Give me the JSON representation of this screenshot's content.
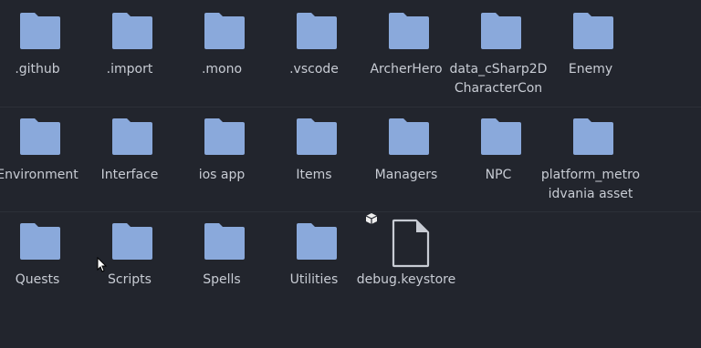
{
  "colors": {
    "background": "#22252d",
    "folder": "#8aa9db",
    "label": "#c8ccd4",
    "file_outline": "#c8ccd4"
  },
  "items": [
    {
      "label": ".github",
      "type": "folder"
    },
    {
      "label": ".import",
      "type": "folder"
    },
    {
      "label": ".mono",
      "type": "folder"
    },
    {
      "label": ".vscode",
      "type": "folder"
    },
    {
      "label": "ArcherHero",
      "type": "folder"
    },
    {
      "label": "data_cSharp2DCharacterCon",
      "type": "folder"
    },
    {
      "label": "Enemy",
      "type": "folder"
    },
    {
      "label": "Environment",
      "type": "folder"
    },
    {
      "label": "Interface",
      "type": "folder"
    },
    {
      "label": "ios app",
      "type": "folder"
    },
    {
      "label": "Items",
      "type": "folder"
    },
    {
      "label": "Managers",
      "type": "folder"
    },
    {
      "label": "NPC",
      "type": "folder"
    },
    {
      "label": "platform_metroidvania asset",
      "type": "folder"
    },
    {
      "label": "Quests",
      "type": "folder"
    },
    {
      "label": "Scripts",
      "type": "folder"
    },
    {
      "label": "Spells",
      "type": "folder"
    },
    {
      "label": "Utilities",
      "type": "folder"
    },
    {
      "label": "debug.keystore",
      "type": "file"
    }
  ]
}
